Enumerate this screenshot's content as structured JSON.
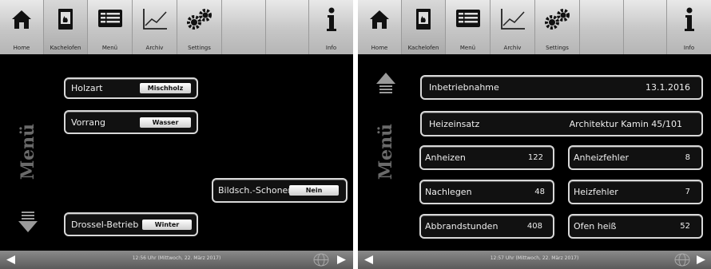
{
  "toolbar": {
    "items": [
      {
        "label": "Home",
        "icon": "home-icon"
      },
      {
        "label": "Kachelofen",
        "icon": "stove-icon"
      },
      {
        "label": "Menü",
        "icon": "menu-list-icon"
      },
      {
        "label": "Archiv",
        "icon": "chart-icon"
      },
      {
        "label": "Settings",
        "icon": "gear-icon"
      },
      {
        "label": "Info",
        "icon": "info-icon"
      }
    ]
  },
  "sidebar": {
    "title": "Menü"
  },
  "left_screen": {
    "settings": [
      {
        "label": "Holzart",
        "value": "Mischholz"
      },
      {
        "label": "Vorrang",
        "value": "Wasser"
      },
      {
        "label": "Bildsch.-Schoner",
        "value": "Nein"
      },
      {
        "label": "Drossel-Betrieb",
        "value": "Winter"
      }
    ],
    "status_time": "12:56 Uhr (Mittwoch, 22. März 2017)"
  },
  "right_screen": {
    "info_rows": [
      {
        "label": "Inbetriebnahme",
        "value": "13.1.2016"
      },
      {
        "label": "Heizeinsatz",
        "value": "Architektur Kamin 45/101"
      }
    ],
    "stats": [
      {
        "label": "Anheizen",
        "value": "122"
      },
      {
        "label": "Anheizfehler",
        "value": "8"
      },
      {
        "label": "Nachlegen",
        "value": "48"
      },
      {
        "label": "Heizfehler",
        "value": "7"
      },
      {
        "label": "Abbrandstunden",
        "value": "408"
      },
      {
        "label": "Ofen heiß",
        "value": "52"
      }
    ],
    "status_time": "12:57 Uhr (Mittwoch, 22. März 2017)"
  },
  "colors": {
    "background": "#000000",
    "toolbar": "#c8c8c8",
    "border": "#d8d8d8",
    "status_bar": "#6e6e6e"
  }
}
